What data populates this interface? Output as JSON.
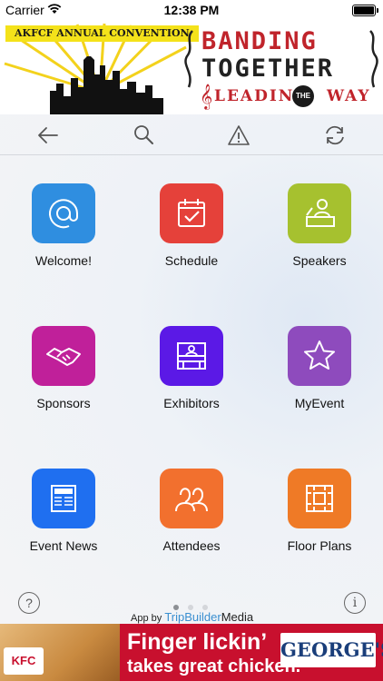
{
  "status": {
    "carrier": "Carrier",
    "time": "12:38 PM"
  },
  "banner": {
    "ribbon": "AKFCF ANNUAL CONVENTION",
    "title_line1": "BANDING",
    "title_line2": "TOGETHER",
    "title_leading": "LEADING",
    "title_the": "THE",
    "title_way": "WAY"
  },
  "toolbar": {
    "back": "back-arrow-icon",
    "search": "search-icon",
    "alert": "warning-icon",
    "refresh": "refresh-icon"
  },
  "tiles": [
    {
      "label": "Welcome!",
      "color": "#2f8ee0",
      "icon": "at-sign-icon"
    },
    {
      "label": "Schedule",
      "color": "#e5413a",
      "icon": "calendar-check-icon"
    },
    {
      "label": "Speakers",
      "color": "#a6c12f",
      "icon": "speaker-podium-icon"
    },
    {
      "label": "Sponsors",
      "color": "#c0209a",
      "icon": "handshake-icon"
    },
    {
      "label": "Exhibitors",
      "color": "#5b19e6",
      "icon": "booth-icon"
    },
    {
      "label": "MyEvent",
      "color": "#8e4bbd",
      "icon": "star-icon"
    },
    {
      "label": "Event News",
      "color": "#1f6ff0",
      "icon": "newspaper-icon"
    },
    {
      "label": "Attendees",
      "color": "#f2702e",
      "icon": "people-icon"
    },
    {
      "label": "Floor Plans",
      "color": "#ef7a26",
      "icon": "floor-plan-icon"
    }
  ],
  "pager": {
    "pages": 3,
    "current": 1
  },
  "footer": {
    "help": "?",
    "info": "i",
    "credit_prefix": "App by",
    "credit_brand": "TripBuilder",
    "credit_brand2": "Media"
  },
  "ad": {
    "kfc": "KFC",
    "slogan_line1": "Finger lickin’",
    "slogan_line2": "takes great chicken.",
    "georges": "GEORGE'S"
  }
}
